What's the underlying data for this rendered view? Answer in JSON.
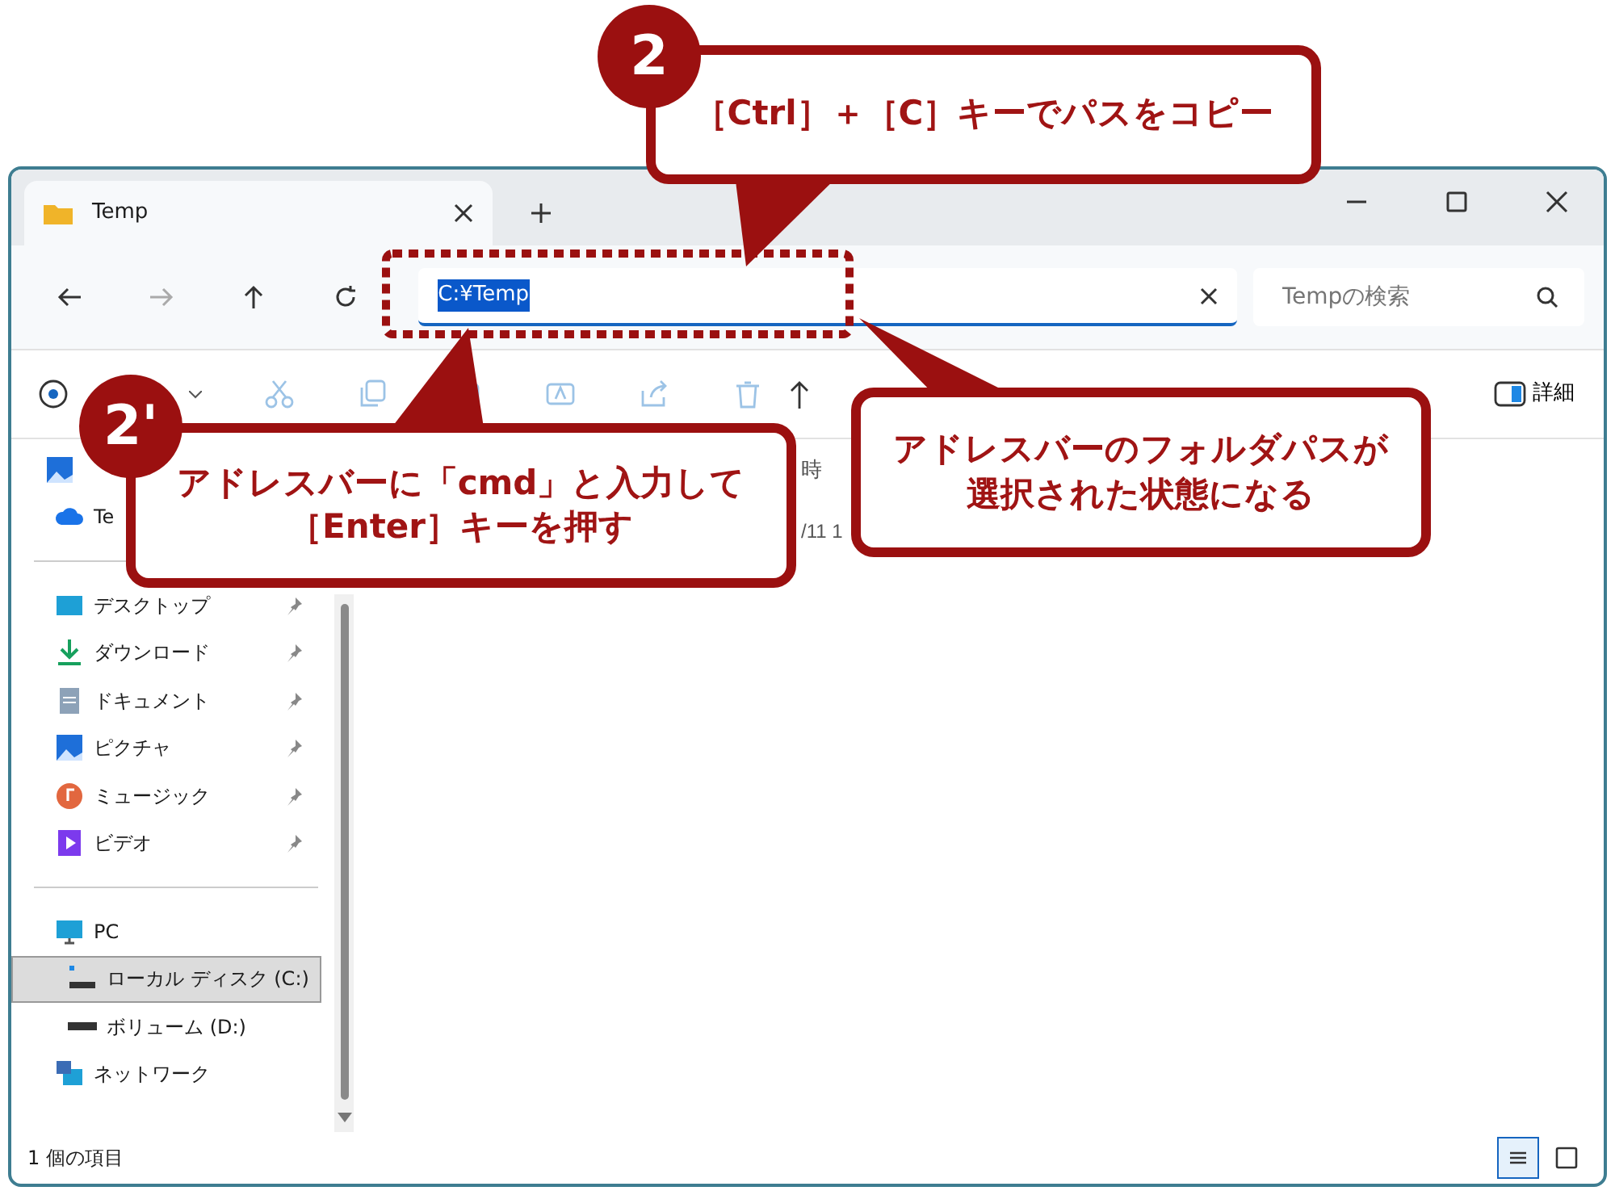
{
  "window": {
    "tab": {
      "title": "Temp",
      "selected": true
    }
  },
  "nav": [
    {
      "kind": "back",
      "disabled": false
    },
    {
      "kind": "forward",
      "disabled": true
    },
    {
      "kind": "up",
      "disabled": false
    },
    {
      "kind": "refresh",
      "disabled": false
    }
  ],
  "address_bar": {
    "value": "C:¥Temp",
    "selected": true
  },
  "search": {
    "placeholder": "Tempの検索"
  },
  "toolbar": {
    "items": [
      {
        "kind": "new",
        "disabled": false
      },
      {
        "kind": "cut",
        "disabled": true
      },
      {
        "kind": "copy",
        "disabled": true
      },
      {
        "kind": "paste",
        "disabled": true
      },
      {
        "kind": "rename",
        "disabled": true
      },
      {
        "kind": "share",
        "disabled": true
      },
      {
        "kind": "delete",
        "disabled": true
      },
      {
        "kind": "sort",
        "disabled": false
      }
    ],
    "details": "詳細"
  },
  "sidebar": {
    "groups": [
      [
        {
          "kind": "gallery",
          "selected": false
        },
        {
          "kind": "cloud",
          "label": "Te",
          "selected": false
        }
      ],
      [
        {
          "kind": "desktop",
          "label": "デスクトップ",
          "pinned": true,
          "selected": false
        },
        {
          "kind": "download",
          "label": "ダウンロード",
          "pinned": true,
          "selected": false
        },
        {
          "kind": "document",
          "label": "ドキュメント",
          "pinned": true,
          "selected": false
        },
        {
          "kind": "picture",
          "label": "ピクチャ",
          "pinned": true,
          "selected": false
        },
        {
          "kind": "music",
          "label": "ミュージック",
          "pinned": true,
          "selected": false
        },
        {
          "kind": "video",
          "label": "ビデオ",
          "pinned": true,
          "selected": false
        }
      ],
      [
        {
          "kind": "pc",
          "label": "PC",
          "selected": false,
          "children": [
            {
              "kind": "drive-c",
              "label": "ローカル ディスク (C:)",
              "selected": true
            },
            {
              "kind": "drive",
              "label": "ボリューム (D:)",
              "selected": false
            }
          ]
        },
        {
          "kind": "network",
          "label": "ネットワーク",
          "selected": false
        }
      ]
    ]
  },
  "content": {
    "column_fragment": "時",
    "cell_fragment": "/11 1"
  },
  "status_bar": {
    "text": "1 個の項目",
    "views": [
      {
        "kind": "details",
        "selected": true
      },
      {
        "kind": "tiles",
        "selected": false
      }
    ]
  },
  "callouts": [
    {
      "step": "2",
      "lines": [
        "［Ctrl］＋［C］キーでパスをコピー"
      ]
    },
    {
      "step": "2'",
      "lines": [
        "アドレスバーに「cmd」と入力して",
        "［Enter］キーを押す"
      ]
    },
    {
      "lines": [
        "アドレスバーのフォルダパスが",
        "選択された状態になる"
      ]
    }
  ]
}
